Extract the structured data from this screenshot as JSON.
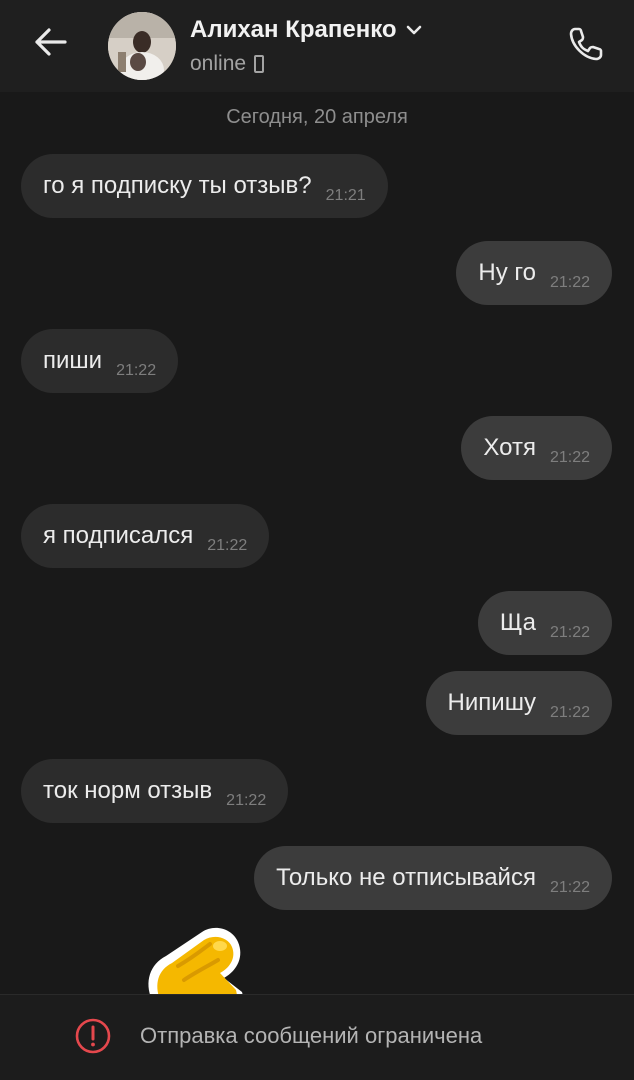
{
  "header": {
    "contact_name": "Алихан Крапенко",
    "status": "online"
  },
  "chat": {
    "date_separator": "Сегодня, 20 апреля",
    "messages": [
      {
        "direction": "in",
        "text": "го я подписку ты отзыв?",
        "time": "21:21"
      },
      {
        "direction": "out",
        "text": "Ну го",
        "time": "21:22"
      },
      {
        "direction": "in",
        "text": "пиши",
        "time": "21:22"
      },
      {
        "direction": "out",
        "text": "Хотя",
        "time": "21:22"
      },
      {
        "direction": "in",
        "text": "я подписался",
        "time": "21:22"
      },
      {
        "direction": "out",
        "text": "Ща",
        "time": "21:22"
      },
      {
        "direction": "out",
        "text": "Нипишу",
        "time": "21:22"
      },
      {
        "direction": "in",
        "text": "ток норм отзыв",
        "time": "21:22"
      },
      {
        "direction": "out",
        "text": "Только не отписывайся",
        "time": "21:22"
      }
    ]
  },
  "footer": {
    "restricted_notice": "Отправка сообщений ограничена"
  },
  "colors": {
    "background": "#191919",
    "incoming_bubble": "#2c2c2c",
    "outgoing_bubble": "#3c3c3c",
    "warning": "#e5484d",
    "sticker_yellow": "#f5b800"
  },
  "icons": {
    "back": "arrow-left-icon",
    "expand": "chevron-down-icon",
    "device": "mobile-device-icon",
    "call": "phone-icon",
    "warning": "exclamation-circle-icon"
  }
}
